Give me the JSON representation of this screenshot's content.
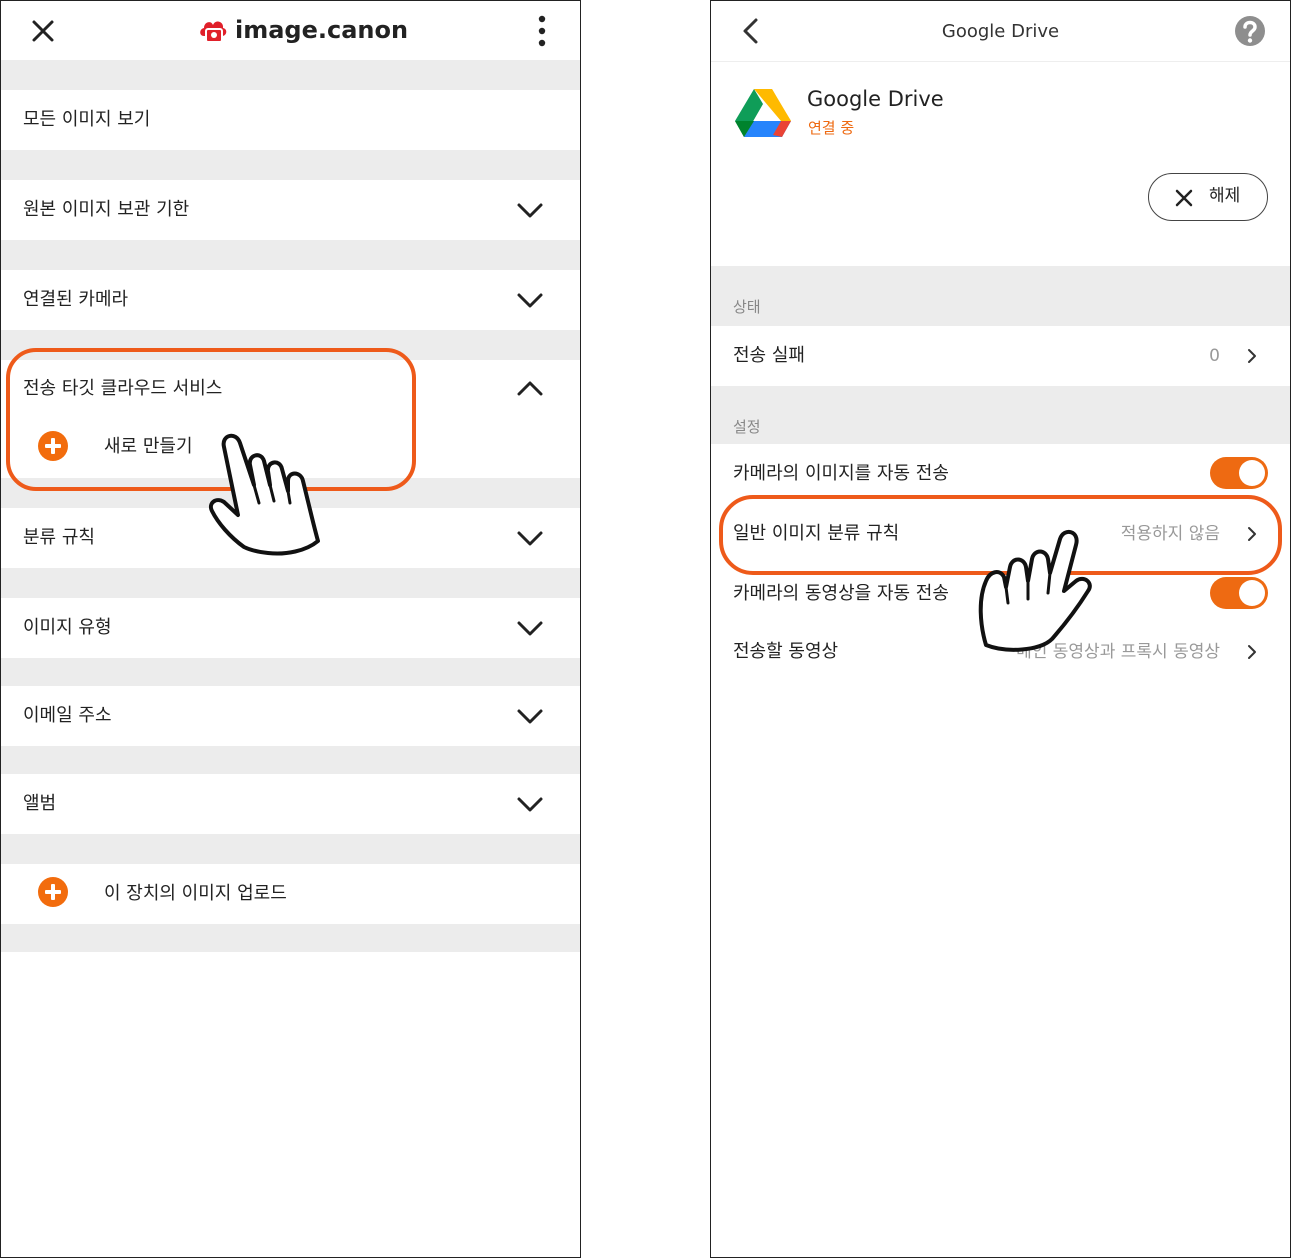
{
  "left": {
    "brand": "image.canon",
    "menu_items": [
      {
        "label": "모든 이미지 보기"
      },
      {
        "label": "원본 이미지 보관 기한"
      },
      {
        "label": "연결된 카메라"
      },
      {
        "label": "전송 타깃 클라우드 서비스"
      },
      {
        "label": "분류 규칙"
      },
      {
        "label": "이미지 유형"
      },
      {
        "label": "이메일 주소"
      },
      {
        "label": "앨범"
      }
    ],
    "new_item_label": "새로 만들기",
    "upload_label": "이 장치의 이미지 업로드"
  },
  "right": {
    "title": "Google Drive",
    "service_name": "Google Drive",
    "service_status": "연결 중",
    "disconnect_label": "해제",
    "status_section": "상태",
    "failed_label": "전송 실패",
    "failed_count": "0",
    "settings_section": "설정",
    "auto_image_label": "카메라의 이미지를 자동 전송",
    "auto_image_on": true,
    "sort_rule_label": "일반 이미지 분류 규칙",
    "sort_rule_value": "적용하지 않음",
    "auto_video_label": "카메라의 동영상을 자동 전송",
    "auto_video_on": true,
    "video_label": "전송할 동영상",
    "video_value": "메인 동영상과 프록시 동영상"
  },
  "colors": {
    "accent": "#ee6a12",
    "highlight": "#ee5a1a",
    "brand_red": "#e0202a",
    "section_bg": "#ececec"
  }
}
